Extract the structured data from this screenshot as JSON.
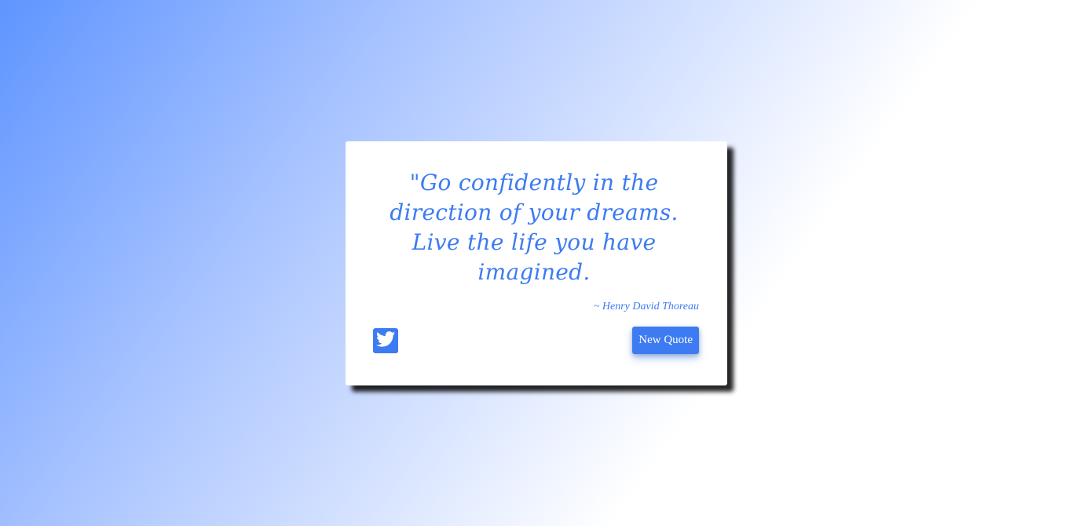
{
  "quote": {
    "text": "\"Go confidently in the direction of your dreams. Live the life you have imagined.",
    "author": "~ Henry David Thoreau"
  },
  "actions": {
    "tweet_icon": "twitter-icon",
    "new_quote_label": "New Quote"
  },
  "colors": {
    "accent": "#3d7bf2",
    "card": "#ffffff",
    "gradient_start": "#5f95ff",
    "gradient_end": "#ffffff"
  }
}
